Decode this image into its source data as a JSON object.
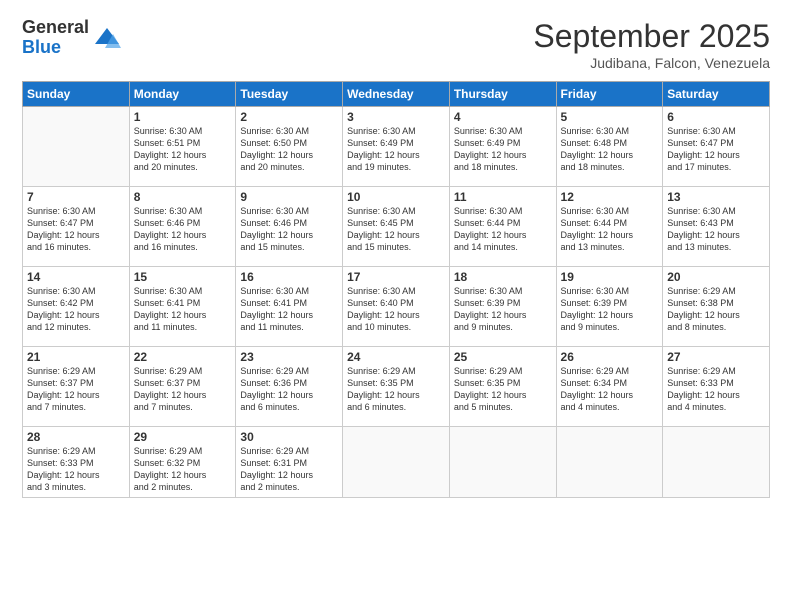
{
  "logo": {
    "general": "General",
    "blue": "Blue"
  },
  "header": {
    "title": "September 2025",
    "location": "Judibana, Falcon, Venezuela"
  },
  "weekdays": [
    "Sunday",
    "Monday",
    "Tuesday",
    "Wednesday",
    "Thursday",
    "Friday",
    "Saturday"
  ],
  "weeks": [
    [
      {
        "day": "",
        "info": ""
      },
      {
        "day": "1",
        "info": "Sunrise: 6:30 AM\nSunset: 6:51 PM\nDaylight: 12 hours\nand 20 minutes."
      },
      {
        "day": "2",
        "info": "Sunrise: 6:30 AM\nSunset: 6:50 PM\nDaylight: 12 hours\nand 20 minutes."
      },
      {
        "day": "3",
        "info": "Sunrise: 6:30 AM\nSunset: 6:49 PM\nDaylight: 12 hours\nand 19 minutes."
      },
      {
        "day": "4",
        "info": "Sunrise: 6:30 AM\nSunset: 6:49 PM\nDaylight: 12 hours\nand 18 minutes."
      },
      {
        "day": "5",
        "info": "Sunrise: 6:30 AM\nSunset: 6:48 PM\nDaylight: 12 hours\nand 18 minutes."
      },
      {
        "day": "6",
        "info": "Sunrise: 6:30 AM\nSunset: 6:47 PM\nDaylight: 12 hours\nand 17 minutes."
      }
    ],
    [
      {
        "day": "7",
        "info": "Sunrise: 6:30 AM\nSunset: 6:47 PM\nDaylight: 12 hours\nand 16 minutes."
      },
      {
        "day": "8",
        "info": "Sunrise: 6:30 AM\nSunset: 6:46 PM\nDaylight: 12 hours\nand 16 minutes."
      },
      {
        "day": "9",
        "info": "Sunrise: 6:30 AM\nSunset: 6:46 PM\nDaylight: 12 hours\nand 15 minutes."
      },
      {
        "day": "10",
        "info": "Sunrise: 6:30 AM\nSunset: 6:45 PM\nDaylight: 12 hours\nand 15 minutes."
      },
      {
        "day": "11",
        "info": "Sunrise: 6:30 AM\nSunset: 6:44 PM\nDaylight: 12 hours\nand 14 minutes."
      },
      {
        "day": "12",
        "info": "Sunrise: 6:30 AM\nSunset: 6:44 PM\nDaylight: 12 hours\nand 13 minutes."
      },
      {
        "day": "13",
        "info": "Sunrise: 6:30 AM\nSunset: 6:43 PM\nDaylight: 12 hours\nand 13 minutes."
      }
    ],
    [
      {
        "day": "14",
        "info": "Sunrise: 6:30 AM\nSunset: 6:42 PM\nDaylight: 12 hours\nand 12 minutes."
      },
      {
        "day": "15",
        "info": "Sunrise: 6:30 AM\nSunset: 6:41 PM\nDaylight: 12 hours\nand 11 minutes."
      },
      {
        "day": "16",
        "info": "Sunrise: 6:30 AM\nSunset: 6:41 PM\nDaylight: 12 hours\nand 11 minutes."
      },
      {
        "day": "17",
        "info": "Sunrise: 6:30 AM\nSunset: 6:40 PM\nDaylight: 12 hours\nand 10 minutes."
      },
      {
        "day": "18",
        "info": "Sunrise: 6:30 AM\nSunset: 6:39 PM\nDaylight: 12 hours\nand 9 minutes."
      },
      {
        "day": "19",
        "info": "Sunrise: 6:30 AM\nSunset: 6:39 PM\nDaylight: 12 hours\nand 9 minutes."
      },
      {
        "day": "20",
        "info": "Sunrise: 6:29 AM\nSunset: 6:38 PM\nDaylight: 12 hours\nand 8 minutes."
      }
    ],
    [
      {
        "day": "21",
        "info": "Sunrise: 6:29 AM\nSunset: 6:37 PM\nDaylight: 12 hours\nand 7 minutes."
      },
      {
        "day": "22",
        "info": "Sunrise: 6:29 AM\nSunset: 6:37 PM\nDaylight: 12 hours\nand 7 minutes."
      },
      {
        "day": "23",
        "info": "Sunrise: 6:29 AM\nSunset: 6:36 PM\nDaylight: 12 hours\nand 6 minutes."
      },
      {
        "day": "24",
        "info": "Sunrise: 6:29 AM\nSunset: 6:35 PM\nDaylight: 12 hours\nand 6 minutes."
      },
      {
        "day": "25",
        "info": "Sunrise: 6:29 AM\nSunset: 6:35 PM\nDaylight: 12 hours\nand 5 minutes."
      },
      {
        "day": "26",
        "info": "Sunrise: 6:29 AM\nSunset: 6:34 PM\nDaylight: 12 hours\nand 4 minutes."
      },
      {
        "day": "27",
        "info": "Sunrise: 6:29 AM\nSunset: 6:33 PM\nDaylight: 12 hours\nand 4 minutes."
      }
    ],
    [
      {
        "day": "28",
        "info": "Sunrise: 6:29 AM\nSunset: 6:33 PM\nDaylight: 12 hours\nand 3 minutes."
      },
      {
        "day": "29",
        "info": "Sunrise: 6:29 AM\nSunset: 6:32 PM\nDaylight: 12 hours\nand 2 minutes."
      },
      {
        "day": "30",
        "info": "Sunrise: 6:29 AM\nSunset: 6:31 PM\nDaylight: 12 hours\nand 2 minutes."
      },
      {
        "day": "",
        "info": ""
      },
      {
        "day": "",
        "info": ""
      },
      {
        "day": "",
        "info": ""
      },
      {
        "day": "",
        "info": ""
      }
    ]
  ]
}
